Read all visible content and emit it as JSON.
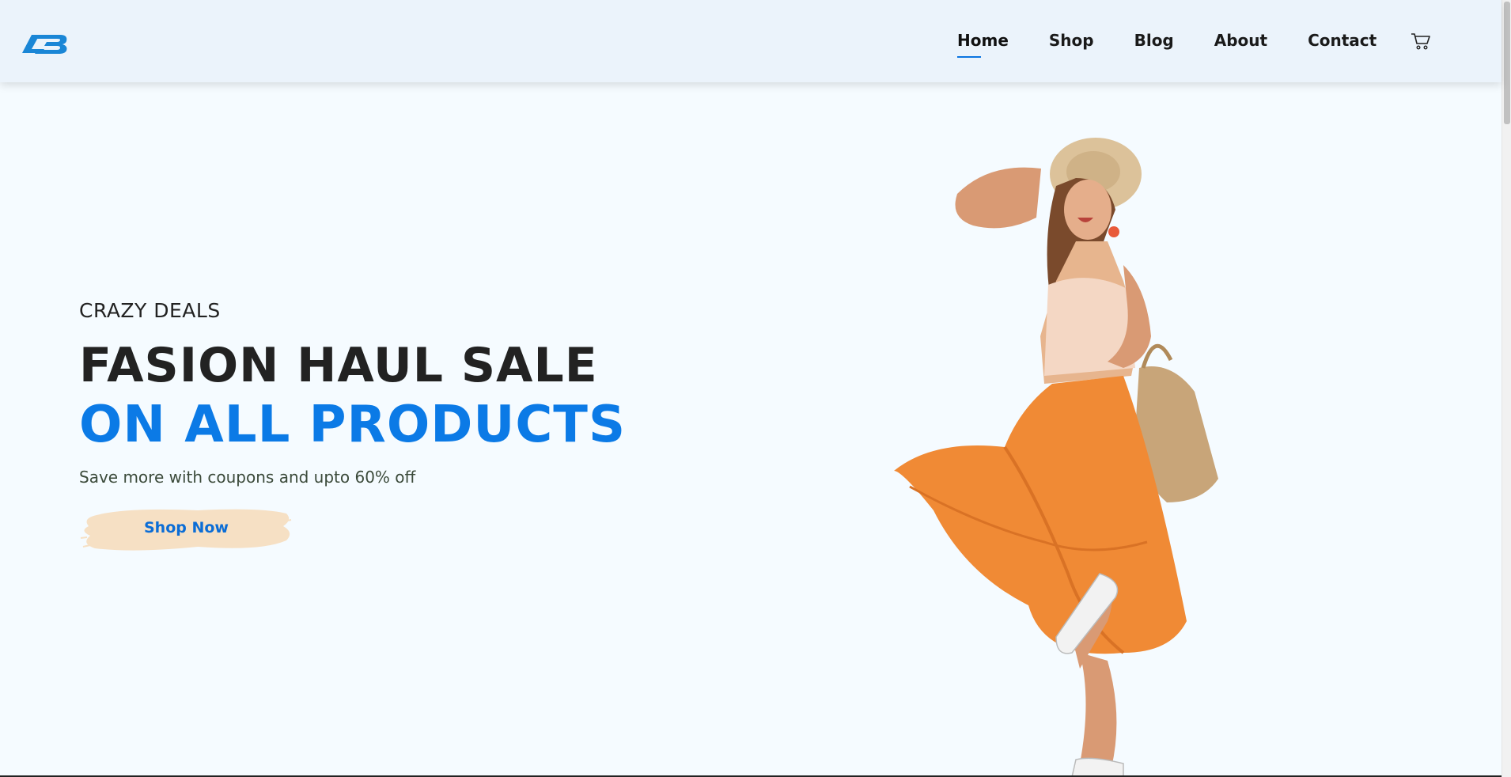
{
  "nav": {
    "items": [
      {
        "label": "Home",
        "active": true
      },
      {
        "label": "Shop",
        "active": false
      },
      {
        "label": "Blog",
        "active": false
      },
      {
        "label": "About",
        "active": false
      },
      {
        "label": "Contact",
        "active": false
      }
    ],
    "cart_icon": "cart-icon"
  },
  "hero": {
    "kicker": "CRAZY DEALS",
    "headline": "FASION HAUL SALE",
    "headline_accent": "ON ALL PRODUCTS",
    "subtext": "Save more with coupons and upto 60% off",
    "button_label": "Shop Now"
  },
  "colors": {
    "accent": "#0b7ae6",
    "header_bg": "#ebf3fb",
    "page_bg": "#f5fbff",
    "button_brush": "#f6e0c4",
    "skirt": "#f08a35"
  }
}
